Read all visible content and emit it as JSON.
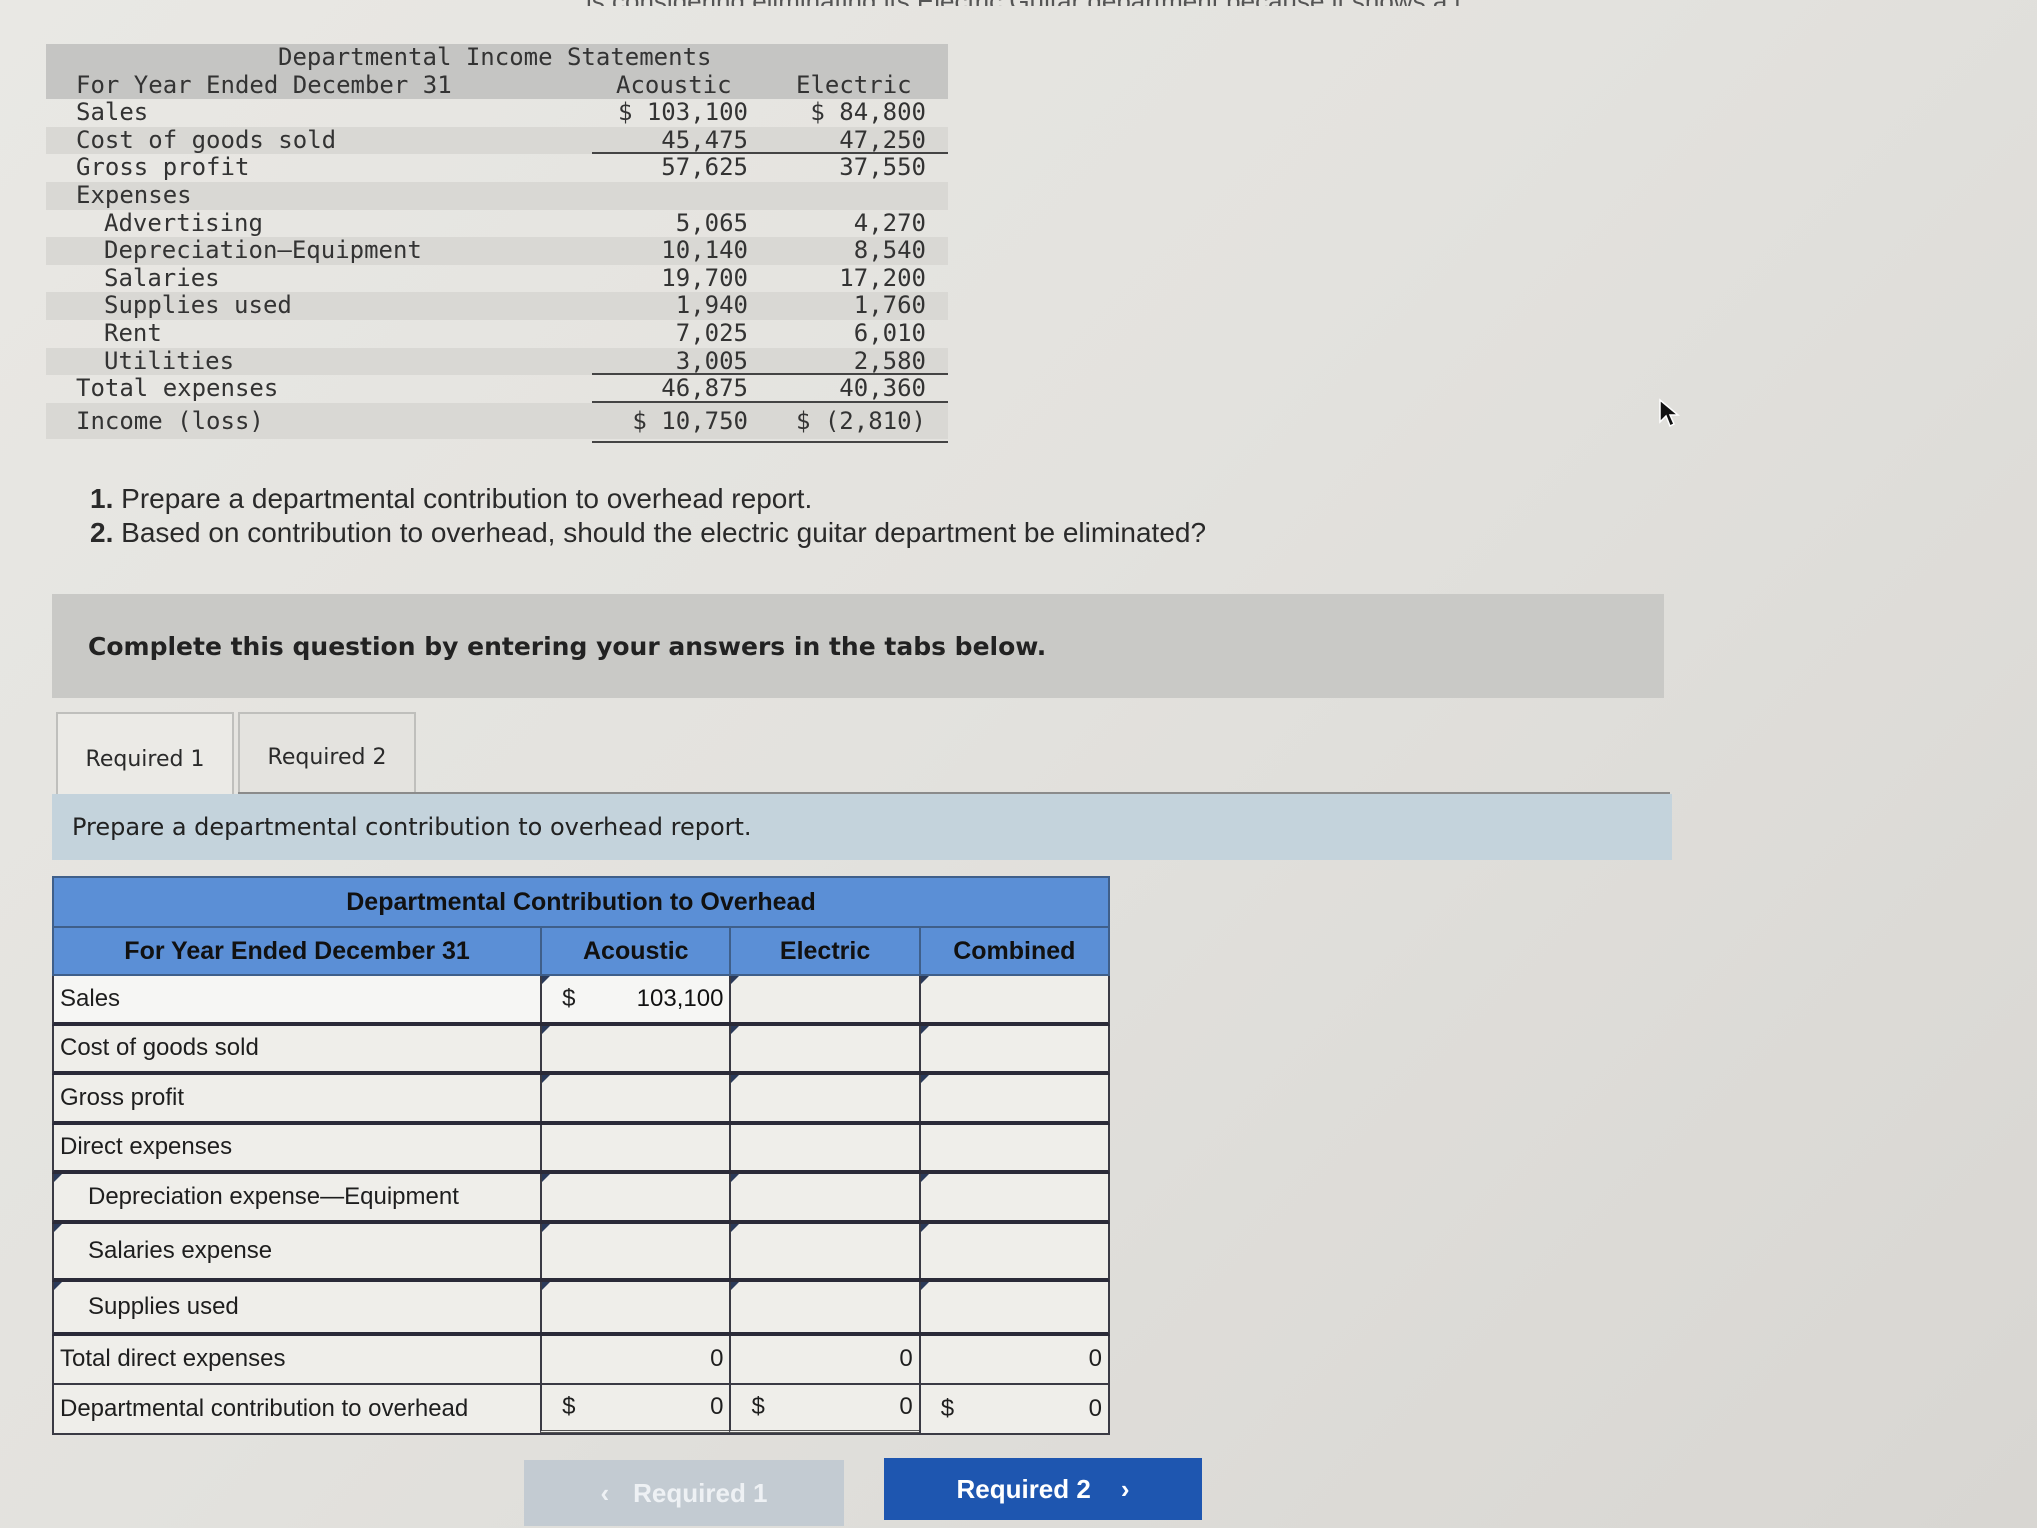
{
  "top_cut_text": "…is considering eliminating its Electric Guitar department because it shows a loss.",
  "income_statement": {
    "title": "Departmental Income Statements",
    "period": "For Year Ended December 31",
    "columns": [
      "Acoustic",
      "Electric"
    ],
    "rows": [
      {
        "label": "Sales",
        "acoustic": "$ 103,100",
        "electric": "$ 84,800",
        "indent": false
      },
      {
        "label": "Cost of goods sold",
        "acoustic": "45,475",
        "electric": "47,250",
        "indent": false
      },
      {
        "label": "Gross profit",
        "acoustic": "57,625",
        "electric": "37,550",
        "indent": false
      },
      {
        "label": "Expenses",
        "acoustic": "",
        "electric": "",
        "indent": false
      },
      {
        "label": "Advertising",
        "acoustic": "5,065",
        "electric": "4,270",
        "indent": true
      },
      {
        "label": "Depreciation—Equipment",
        "acoustic": "10,140",
        "electric": "8,540",
        "indent": true
      },
      {
        "label": "Salaries",
        "acoustic": "19,700",
        "electric": "17,200",
        "indent": true
      },
      {
        "label": "Supplies used",
        "acoustic": "1,940",
        "electric": "1,760",
        "indent": true
      },
      {
        "label": "Rent",
        "acoustic": "7,025",
        "electric": "6,010",
        "indent": true
      },
      {
        "label": "Utilities",
        "acoustic": "3,005",
        "electric": "2,580",
        "indent": true
      },
      {
        "label": "Total expenses",
        "acoustic": "46,875",
        "electric": "40,360",
        "indent": false
      },
      {
        "label": "Income (loss)",
        "acoustic": "$ 10,750",
        "electric": "$ (2,810)",
        "indent": false
      }
    ]
  },
  "questions": [
    {
      "num": "1.",
      "text": "Prepare a departmental contribution to overhead report."
    },
    {
      "num": "2.",
      "text": "Based on contribution to overhead, should the electric guitar department be eliminated?"
    }
  ],
  "banner": "Complete this question by entering your answers in the tabs below.",
  "tabs": [
    {
      "label": "Required 1",
      "active": true
    },
    {
      "label": "Required 2",
      "active": false
    }
  ],
  "instruction": "Prepare a departmental contribution to overhead report.",
  "answer_table": {
    "title": "Departmental Contribution to Overhead",
    "period": "For Year Ended December 31",
    "columns": [
      "Acoustic",
      "Electric",
      "Combined"
    ],
    "rows": {
      "sales": {
        "label": "Sales",
        "acoustic": "103,100",
        "electric": "",
        "combined": ""
      },
      "cogs": {
        "label": "Cost of goods sold",
        "acoustic": "",
        "electric": "",
        "combined": ""
      },
      "gross_profit": {
        "label": "Gross profit",
        "acoustic": "",
        "electric": "",
        "combined": ""
      },
      "direct_expenses": {
        "label": "Direct expenses"
      },
      "depreciation": {
        "label": "Depreciation expense—Equipment",
        "acoustic": "",
        "electric": "",
        "combined": ""
      },
      "salaries": {
        "label": "Salaries expense",
        "acoustic": "",
        "electric": "",
        "combined": ""
      },
      "supplies": {
        "label": "Supplies used",
        "acoustic": "",
        "electric": "",
        "combined": ""
      },
      "total_direct": {
        "label": "Total direct expenses",
        "acoustic": "0",
        "electric": "0",
        "combined": "0"
      },
      "contribution": {
        "label": "Departmental contribution to overhead",
        "acoustic": "0",
        "electric": "0",
        "combined": "0"
      }
    },
    "currency_symbol": "$"
  },
  "nav": {
    "prev_label": "Required 1",
    "next_label": "Required 2",
    "prev_icon": "chevron-left-icon",
    "next_icon": "chevron-right-icon"
  },
  "colors": {
    "table_header": "#5b8fd6",
    "next_button": "#1e56b0",
    "prev_button_disabled": "#c3cbd2",
    "instruction_bar": "#c4d3dc",
    "banner": "#c9c9c6"
  }
}
